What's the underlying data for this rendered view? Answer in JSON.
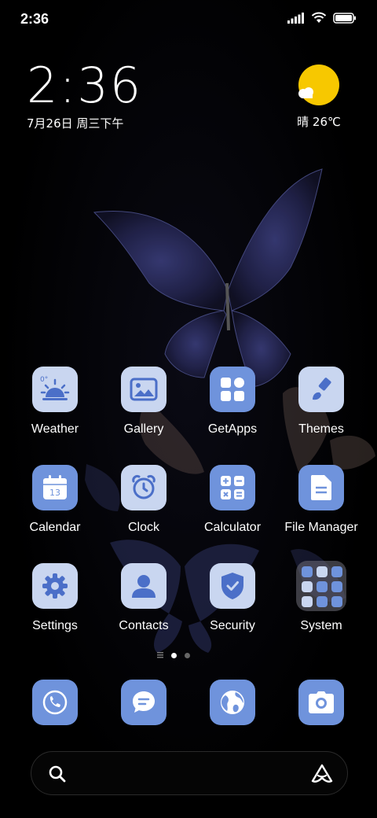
{
  "status_bar": {
    "time": "2:36"
  },
  "clock_widget": {
    "time": "2:36",
    "date": "7月26日 周三下午"
  },
  "weather_widget": {
    "text": "晴 26℃",
    "sun_color": "#f7c800"
  },
  "apps": [
    {
      "label": "Weather",
      "icon": "weather-icon"
    },
    {
      "label": "Gallery",
      "icon": "gallery-icon"
    },
    {
      "label": "GetApps",
      "icon": "getapps-icon"
    },
    {
      "label": "Themes",
      "icon": "themes-icon"
    },
    {
      "label": "Calendar",
      "icon": "calendar-icon"
    },
    {
      "label": "Clock",
      "icon": "clock-icon"
    },
    {
      "label": "Calculator",
      "icon": "calculator-icon"
    },
    {
      "label": "File Manager",
      "icon": "file-manager-icon"
    },
    {
      "label": "Settings",
      "icon": "gear-icon"
    },
    {
      "label": "Contacts",
      "icon": "contacts-icon"
    },
    {
      "label": "Security",
      "icon": "shield-icon"
    },
    {
      "label": "System",
      "icon": "folder-icon"
    }
  ],
  "weather_icon_text": "0°",
  "calendar_icon_text": "13",
  "page_indicator": {
    "current": 2,
    "total": 3
  },
  "dock": [
    "phone-icon",
    "messages-icon",
    "browser-icon",
    "camera-icon"
  ],
  "colors": {
    "icon_light": "#c9d6f0",
    "icon_blue": "#6f93dc"
  }
}
